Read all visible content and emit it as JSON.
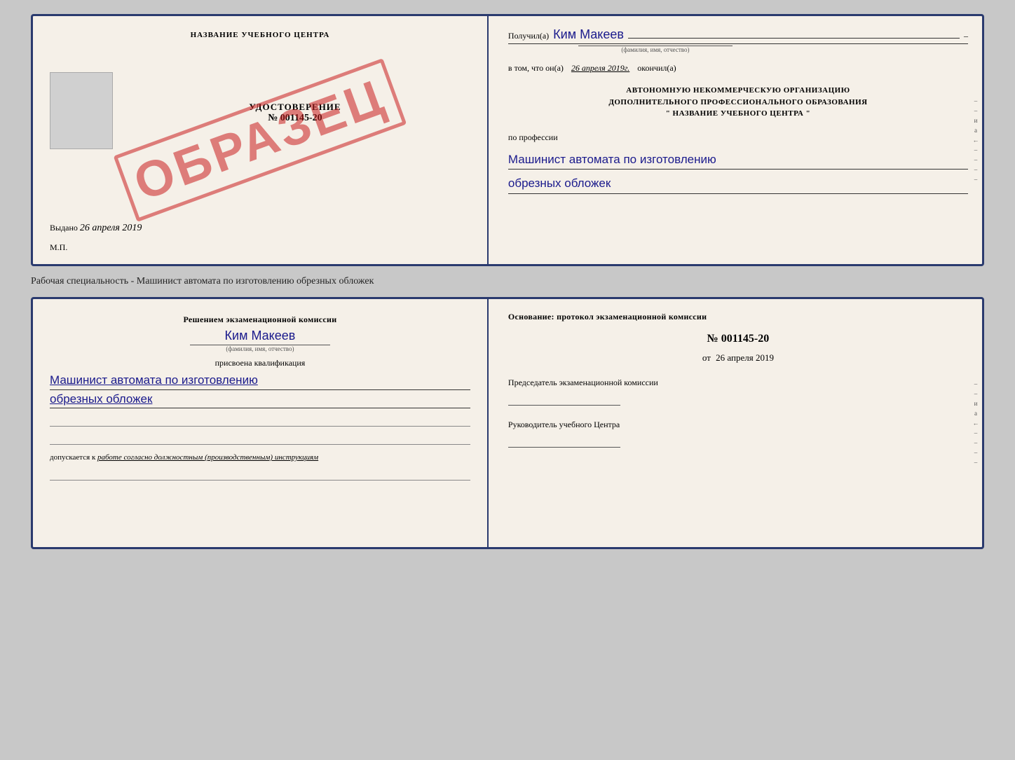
{
  "page": {
    "background": "#c8c8c8"
  },
  "cert": {
    "left": {
      "school_title": "НАЗВАНИЕ УЧЕБНОГО ЦЕНТРА",
      "doc_type": "УДОСТОВЕРЕНИЕ",
      "doc_number": "№ 001145-20",
      "issued_label": "Выдано",
      "issued_date": "26 апреля 2019",
      "mp_label": "М.П.",
      "stamp": "ОБРАЗЕЦ"
    },
    "right": {
      "received_label": "Получил(а)",
      "recipient_name": "Ким Макеев",
      "fio_hint": "(фамилия, имя, отчество)",
      "date_label": "в том, что он(а)",
      "date_value": "26 апреля 2019г.",
      "finished_label": "окончил(а)",
      "org_line1": "АВТОНОМНУЮ НЕКОММЕРЧЕСКУЮ ОРГАНИЗАЦИЮ",
      "org_line2": "ДОПОЛНИТЕЛЬНОГО ПРОФЕССИОНАЛЬНОГО ОБРАЗОВАНИЯ",
      "org_name": "\"  НАЗВАНИЕ УЧЕБНОГО ЦЕНТРА  \"",
      "profession_label": "по профессии",
      "profession_line1": "Машинист автомата по изготовлению",
      "profession_line2": "обрезных обложек"
    }
  },
  "specialty": {
    "text": "Рабочая специальность - Машинист автомата по изготовлению обрезных обложек"
  },
  "qual": {
    "left": {
      "decision_text": "Решением экзаменационной комиссии",
      "person_name": "Ким Макеев",
      "fio_hint": "(фамилия, имя, отчество)",
      "assigned_label": "присвоена квалификация",
      "profession_line1": "Машинист автомата по изготовлению",
      "profession_line2": "обрезных обложек",
      "допускается_label": "допускается к",
      "допускается_text": "работе согласно должностным (производственным) инструкциям"
    },
    "right": {
      "basis_title": "Основание: протокол экзаменационной комиссии",
      "protocol_number": "№  001145-20",
      "date_prefix": "от",
      "date_value": "26 апреля 2019",
      "chairman_label": "Председатель экзаменационной комиссии",
      "director_label": "Руководитель учебного Центра"
    }
  }
}
